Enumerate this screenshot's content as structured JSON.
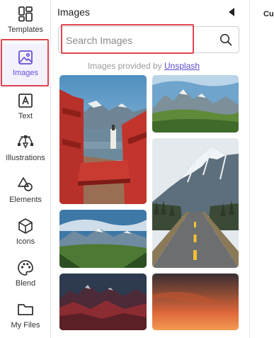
{
  "sidebar": {
    "items": [
      {
        "label": "Templates",
        "icon": "templates-icon"
      },
      {
        "label": "Images",
        "icon": "image-icon"
      },
      {
        "label": "Text",
        "icon": "text-icon"
      },
      {
        "label": "Illustrations",
        "icon": "illustrations-icon"
      },
      {
        "label": "Elements",
        "icon": "elements-icon"
      },
      {
        "label": "Icons",
        "icon": "cube-icon"
      },
      {
        "label": "Blend",
        "icon": "palette-icon"
      },
      {
        "label": "My Files",
        "icon": "folder-icon"
      }
    ],
    "active": "Images",
    "accent": "#6a4dd8"
  },
  "panel": {
    "title": "Images",
    "search": {
      "placeholder": "Search Images",
      "value": ""
    },
    "credit_text": "Images provided by",
    "credit_link": "Unsplash",
    "images": [
      {
        "subject": "red adirondack chairs on dock by mountain lake"
      },
      {
        "subject": "mountains above green hills"
      },
      {
        "subject": "snowy mountain above road and forest"
      },
      {
        "subject": "valley with mountains and clouds"
      },
      {
        "subject": "dark red mountain range at dusk"
      },
      {
        "subject": "orange sunset sky"
      }
    ]
  },
  "right": {
    "label": "Cu"
  },
  "colors": {
    "highlight": "#e0464f",
    "link": "#5b4ad2"
  }
}
